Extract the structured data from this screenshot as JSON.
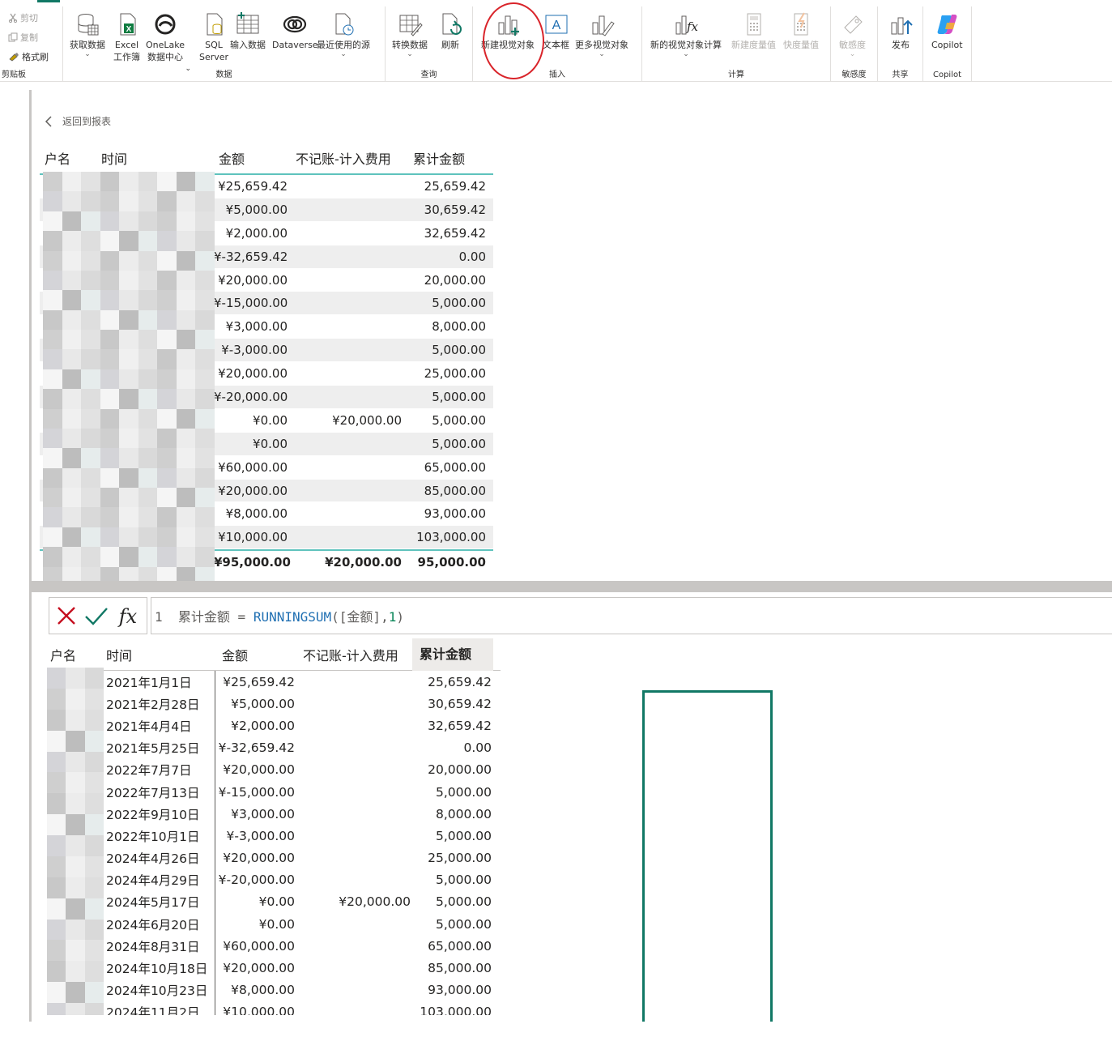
{
  "ribbon": {
    "clipboard": {
      "cut": "剪切",
      "copy": "复制",
      "format_painter": "格式刷",
      "group": "剪贴板"
    },
    "data_group": {
      "get_data": "获取数据",
      "excel_line1": "Excel",
      "excel_line2": "工作簿",
      "onelake_line1": "OneLake",
      "onelake_line2": "数据中心",
      "sql_line1": "SQL",
      "sql_line2": "Server",
      "enter_data": "输入数据",
      "dataverse": "Dataverse",
      "recent_sources": "最近使用的源",
      "group": "数据"
    },
    "query_group": {
      "transform": "转换数据",
      "refresh": "刷新",
      "group": "查询"
    },
    "insert_group": {
      "new_visual": "新建视觉对象",
      "text_box": "文本框",
      "more_visuals": "更多视觉对象",
      "group": "插入"
    },
    "calc_group": {
      "new_visual_calc": "新的视觉对象计算",
      "new_measure": "新建度量值",
      "quick_measure": "快度量值",
      "group": "计算"
    },
    "sensitivity_group": {
      "sensitivity": "敏感度",
      "group": "敏感度"
    },
    "share_group": {
      "publish": "发布",
      "group": "共享"
    },
    "copilot_group": {
      "copilot": "Copilot",
      "group": "Copilot"
    },
    "colors": {
      "accent": "#117865",
      "annotation": "#d9242a"
    }
  },
  "canvas": {
    "back_link": "返回到报表",
    "table": {
      "headers": [
        "户名",
        "时间",
        "金额",
        "不记账-计入费用",
        "累计金额"
      ],
      "rows": [
        {
          "amt": "¥25,659.42",
          "fee": "",
          "cum": "25,659.42"
        },
        {
          "amt": "¥5,000.00",
          "fee": "",
          "cum": "30,659.42"
        },
        {
          "amt": "¥2,000.00",
          "fee": "",
          "cum": "32,659.42"
        },
        {
          "amt": "¥-32,659.42",
          "fee": "",
          "cum": "0.00"
        },
        {
          "amt": "¥20,000.00",
          "fee": "",
          "cum": "20,000.00"
        },
        {
          "amt": "¥-15,000.00",
          "fee": "",
          "cum": "5,000.00"
        },
        {
          "amt": "¥3,000.00",
          "fee": "",
          "cum": "8,000.00"
        },
        {
          "amt": "¥-3,000.00",
          "fee": "",
          "cum": "5,000.00"
        },
        {
          "amt": "¥20,000.00",
          "fee": "",
          "cum": "25,000.00"
        },
        {
          "amt": "¥-20,000.00",
          "fee": "",
          "cum": "5,000.00"
        },
        {
          "amt": "¥0.00",
          "fee": "¥20,000.00",
          "cum": "5,000.00"
        },
        {
          "amt": "¥0.00",
          "fee": "",
          "cum": "5,000.00"
        },
        {
          "amt": "¥60,000.00",
          "fee": "",
          "cum": "65,000.00"
        },
        {
          "amt": "¥20,000.00",
          "fee": "",
          "cum": "85,000.00"
        },
        {
          "amt": "¥8,000.00",
          "fee": "",
          "cum": "93,000.00"
        },
        {
          "amt": "¥10,000.00",
          "fee": "",
          "cum": "103,000.00"
        }
      ],
      "total": {
        "amt": "¥95,000.00",
        "fee": "¥20,000.00",
        "cum": "95,000.00"
      }
    }
  },
  "formula": {
    "line_no": "1",
    "name": "累计金额",
    "op": " = ",
    "func": "RUNNINGSUM",
    "open": "(",
    "col": "[金额]",
    "comma": ",",
    "arg": "1",
    "close": ")"
  },
  "grid": {
    "headers": [
      "户名",
      "时间",
      "金额",
      "不记账-计入费用",
      "累计金额"
    ],
    "rows": [
      {
        "time": "2021年1月1日",
        "amt": "¥25,659.42",
        "fee": "",
        "cum": "25,659.42"
      },
      {
        "time": "2021年2月28日",
        "amt": "¥5,000.00",
        "fee": "",
        "cum": "30,659.42"
      },
      {
        "time": "2021年4月4日",
        "amt": "¥2,000.00",
        "fee": "",
        "cum": "32,659.42"
      },
      {
        "time": "2021年5月25日",
        "amt": "¥-32,659.42",
        "fee": "",
        "cum": "0.00"
      },
      {
        "time": "2022年7月7日",
        "amt": "¥20,000.00",
        "fee": "",
        "cum": "20,000.00"
      },
      {
        "time": "2022年7月13日",
        "amt": "¥-15,000.00",
        "fee": "",
        "cum": "5,000.00"
      },
      {
        "time": "2022年9月10日",
        "amt": "¥3,000.00",
        "fee": "",
        "cum": "8,000.00"
      },
      {
        "time": "2022年10月1日",
        "amt": "¥-3,000.00",
        "fee": "",
        "cum": "5,000.00"
      },
      {
        "time": "2024年4月26日",
        "amt": "¥20,000.00",
        "fee": "",
        "cum": "25,000.00"
      },
      {
        "time": "2024年4月29日",
        "amt": "¥-20,000.00",
        "fee": "",
        "cum": "5,000.00"
      },
      {
        "time": "2024年5月17日",
        "amt": "¥0.00",
        "fee": "¥20,000.00",
        "cum": "5,000.00"
      },
      {
        "time": "2024年6月20日",
        "amt": "¥0.00",
        "fee": "",
        "cum": "5,000.00"
      },
      {
        "time": "2024年8月31日",
        "amt": "¥60,000.00",
        "fee": "",
        "cum": "65,000.00"
      },
      {
        "time": "2024年10月18日",
        "amt": "¥20,000.00",
        "fee": "",
        "cum": "85,000.00"
      },
      {
        "time": "2024年10月23日",
        "amt": "¥8,000.00",
        "fee": "",
        "cum": "93,000.00"
      },
      {
        "time": "2024年11月2日",
        "amt": "¥10,000.00",
        "fee": "",
        "cum": "103,000.00"
      }
    ]
  }
}
